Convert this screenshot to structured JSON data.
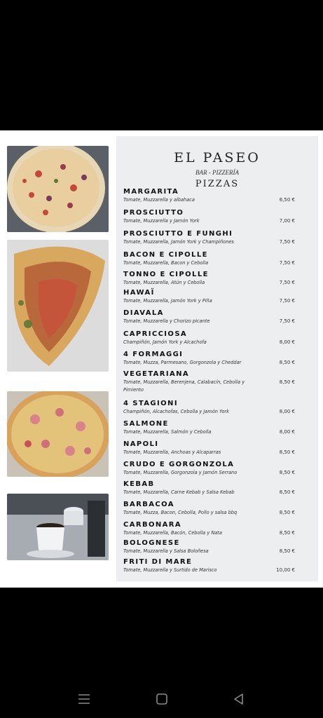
{
  "menu": {
    "title": "EL PASEO",
    "subtitle": "BAR - PIZZERÍA",
    "section": "PIZZAS",
    "items": [
      {
        "name": "MARGARITA",
        "desc": "Tomate, Muzzarella y albahaca",
        "price": "6,50 €"
      },
      {
        "name": "PROSCIUTTO",
        "desc": "Tomate, Muzzarella y Jamón York",
        "price": "7,00 €"
      },
      {
        "name": "PROSCIUTTO E FUNGHI",
        "desc": "Tomate, Muzzarella, Jamón York y Champiñones",
        "price": "7,50 €"
      },
      {
        "name": "BACON E CIPOLLE",
        "desc": "Tomate, Muzzarella, Bacon y Cebolla",
        "price": "7,50 €"
      },
      {
        "name": "TONNO E CIPOLLE",
        "desc": "Tomate, Muzzarella, Atún y Cebolla",
        "price": "7,50 €"
      },
      {
        "name": "HAWAÏ",
        "desc": "Tomate, Muzzarella, Jamón York y Piña",
        "price": "7,50 €"
      },
      {
        "name": "DIAVALA",
        "desc": "Tomate, Muzzarella y Chorizo picante",
        "price": "7,50 €"
      },
      {
        "name": "CAPRICCIOSA",
        "desc": "Champiñón, Jamón York y Alcachofa",
        "price": "8,00 €"
      },
      {
        "name": "4 FORMAGGI",
        "desc": "Tomate, Muzza, Parmesano, Gorgonzola y Cheddar",
        "price": "8,50 €"
      },
      {
        "name": "VEGETARIANA",
        "desc": "Tomate, Muzzarella, Berenjena, Calabacín, Cebolla y Pimiento",
        "price": "8,50 €"
      },
      {
        "name": "4 STAGIONI",
        "desc": "Champiñón, Alcachofas, Cebolla y Jamón York",
        "price": "8,00 €"
      },
      {
        "name": "SALMONE",
        "desc": "Tomate, Muzzarella, Salmón y Cebolla",
        "price": "8,00 €"
      },
      {
        "name": "NAPOLI",
        "desc": "Tomate, Muzzarella, Anchoas y Alcaparras",
        "price": "8,50 €"
      },
      {
        "name": "CRUDO E GORGONZOLA",
        "desc": "Tomate, Muzzarella, Gorgonzola y Jamón Serrano",
        "price": "8,50 €"
      },
      {
        "name": "KEBAB",
        "desc": "Tomate, Muzzarella, Carne Kebab y Salsa Kebab",
        "price": "8,50 €"
      },
      {
        "name": "BARBACOA",
        "desc": "Tomate, Muzza, Bacon, Cebolla, Pollo y salsa bbq",
        "price": "8,50 €"
      },
      {
        "name": "CARBONARA",
        "desc": "Tomate, Muzzarella, Bacón, Cebolla y Nata",
        "price": "8,50 €"
      },
      {
        "name": "BOLOGNESE",
        "desc": "Tomate, Muzzarella y Salsa Boloñesa",
        "price": "8,50 €"
      },
      {
        "name": "FRITI DI MARE",
        "desc": "Tomate, Muzzarella y Surtido de Marisco",
        "price": "10,00 €"
      }
    ]
  },
  "photos": [
    "pizza-photo",
    "calzone-photo",
    "pizza-ham-photo",
    "coffee-cup-photo"
  ],
  "nav": {
    "icons": [
      "menu-icon",
      "home-icon",
      "back-icon"
    ]
  },
  "colors": {
    "background": "#000000",
    "page": "#ffffff",
    "menu_panel": "#eceeef"
  }
}
